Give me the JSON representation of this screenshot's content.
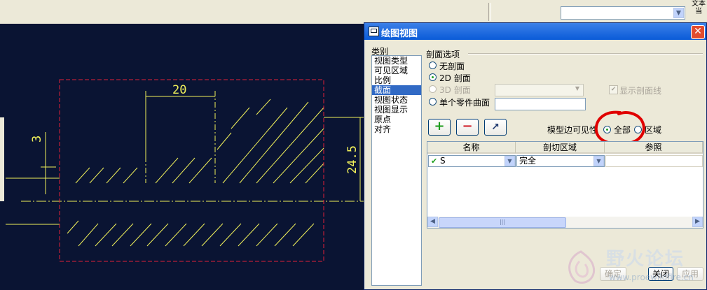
{
  "window": {
    "title": "绘图视图"
  },
  "top_toolbar": {
    "right_label": "文本 当"
  },
  "cad": {
    "dim_width": "20",
    "dim_height": "24.5",
    "dim_left": "3"
  },
  "category": {
    "label": "类别",
    "items": [
      "视图类型",
      "可见区域",
      "比例",
      "截面",
      "视图状态",
      "视图显示",
      "原点",
      "对齐"
    ],
    "selected_index": 3
  },
  "section_options": {
    "group_label": "剖面选项",
    "radio_none": "无剖面",
    "radio_2d": "2D 剖面",
    "radio_3d": "3D 剖面",
    "radio_single_part": "单个零件曲面",
    "show_hatch_label": "显示剖面线",
    "selected": "2D 剖面"
  },
  "toolbar": {
    "add_label": "+",
    "remove_label": "−",
    "edit_label": "↗"
  },
  "model_edge_visibility": {
    "label": "模型边可见性",
    "option_all": "全部",
    "option_area": "区域",
    "selected": "全部"
  },
  "table": {
    "columns": [
      "名称",
      "剖切区域",
      "参照"
    ],
    "rows": [
      {
        "name": "S",
        "region": "完全",
        "reference": ""
      }
    ]
  },
  "buttons": {
    "ok": "确定",
    "close": "关闭",
    "apply": "应用"
  },
  "watermark": {
    "title": "野火论坛",
    "url": "www.proewildfire.cn"
  },
  "colors": {
    "canvas_bg": "#0a1433",
    "cad_yellow": "#f0f05a",
    "cad_red_dash": "#e0203a",
    "annotation_circle": "#e00000",
    "selection": "#316ac5"
  }
}
